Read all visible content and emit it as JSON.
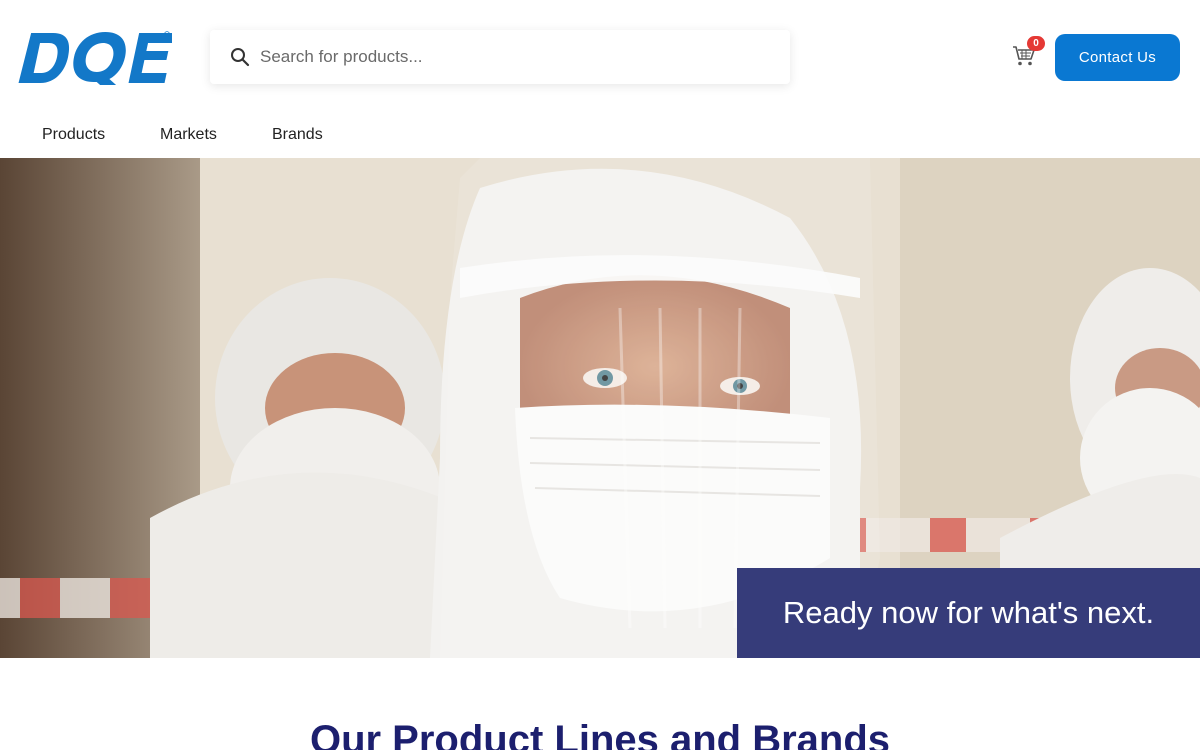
{
  "brand": {
    "logo_text": "DQE",
    "logo_color": "#1378c8"
  },
  "search": {
    "placeholder": "Search for products..."
  },
  "cart": {
    "count": "0",
    "badge_color": "#e53935"
  },
  "header": {
    "contact_label": "Contact Us",
    "contact_color": "#0a78d2"
  },
  "nav": {
    "items": [
      "Products",
      "Markets",
      "Brands"
    ]
  },
  "hero": {
    "caption": "Ready now for what's next.",
    "caption_bg": "#363c7a"
  },
  "section": {
    "title": "Our Product Lines and Brands",
    "title_color": "#1c1f6e"
  },
  "icons": {
    "search": "search-icon",
    "cart": "cart-icon"
  }
}
